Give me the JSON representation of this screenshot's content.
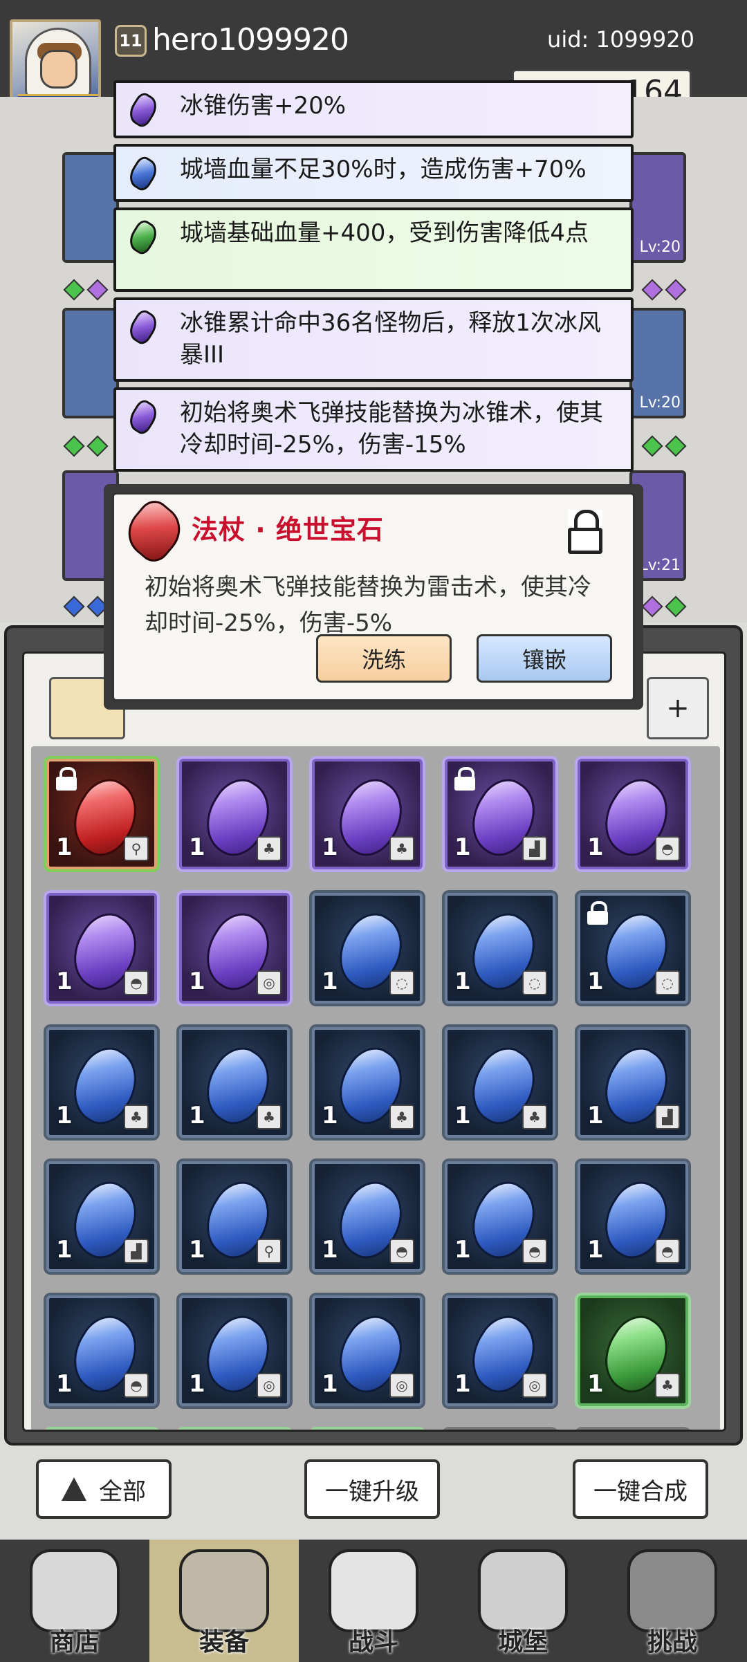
{
  "header": {
    "player_level": "11",
    "player_name": "hero1099920",
    "uid": "uid: 1099920",
    "currency_value": "164"
  },
  "effects": [
    {
      "color": "purple",
      "text": "冰锥伤害+20%"
    },
    {
      "color": "blue",
      "text": "城墙血量不足30%时，造成伤害+70%"
    },
    {
      "color": "green",
      "text": "城墙基础血量+400，受到伤害降低4点"
    },
    {
      "color": "purple",
      "text": "冰锥累计命中36名怪物后，释放1次冰风暴III"
    },
    {
      "color": "purple",
      "text": "初始将奥术飞弹技能替换为冰锥术，使其冷却时间-25%，伤害-15%"
    }
  ],
  "equip_slot_levels": [
    "Lv:20",
    "Lv:20",
    "Lv:21"
  ],
  "gem_popup": {
    "title": "法杖 · 绝世宝石",
    "description": "初始将奥术飞弹技能替换为雷击术，使其冷却时间-25%，伤害-5%",
    "reforge_label": "洗练",
    "inlay_label": "镶嵌",
    "locked": true
  },
  "inventory": {
    "add_button_label": "+",
    "gems": [
      {
        "color": "red",
        "count": "1",
        "slot_icon": "staff-icon",
        "locked": true
      },
      {
        "color": "purple",
        "count": "1",
        "slot_icon": "armor-icon",
        "locked": false
      },
      {
        "color": "purple",
        "count": "1",
        "slot_icon": "armor-icon",
        "locked": false
      },
      {
        "color": "purple",
        "count": "1",
        "slot_icon": "boots-icon",
        "locked": true
      },
      {
        "color": "purple",
        "count": "1",
        "slot_icon": "hat-icon",
        "locked": false
      },
      {
        "color": "purple",
        "count": "1",
        "slot_icon": "hat-icon",
        "locked": false
      },
      {
        "color": "purple",
        "count": "1",
        "slot_icon": "amulet-icon",
        "locked": false
      },
      {
        "color": "blue",
        "count": "1",
        "slot_icon": "ring-icon",
        "locked": false
      },
      {
        "color": "blue",
        "count": "1",
        "slot_icon": "ring-icon",
        "locked": false
      },
      {
        "color": "blue",
        "count": "1",
        "slot_icon": "ring-icon",
        "locked": true
      },
      {
        "color": "blue",
        "count": "1",
        "slot_icon": "armor-icon",
        "locked": false
      },
      {
        "color": "blue",
        "count": "1",
        "slot_icon": "armor-icon",
        "locked": false
      },
      {
        "color": "blue",
        "count": "1",
        "slot_icon": "armor-icon",
        "locked": false
      },
      {
        "color": "blue",
        "count": "1",
        "slot_icon": "armor-icon",
        "locked": false
      },
      {
        "color": "blue",
        "count": "1",
        "slot_icon": "boots-icon",
        "locked": false
      },
      {
        "color": "blue",
        "count": "1",
        "slot_icon": "boots-icon",
        "locked": false
      },
      {
        "color": "blue",
        "count": "1",
        "slot_icon": "staff-icon",
        "locked": false
      },
      {
        "color": "blue",
        "count": "1",
        "slot_icon": "hat-icon",
        "locked": false
      },
      {
        "color": "blue",
        "count": "1",
        "slot_icon": "hat-icon",
        "locked": false
      },
      {
        "color": "blue",
        "count": "1",
        "slot_icon": "hat-icon",
        "locked": false
      },
      {
        "color": "blue",
        "count": "1",
        "slot_icon": "hat-icon",
        "locked": false
      },
      {
        "color": "blue",
        "count": "1",
        "slot_icon": "amulet-icon",
        "locked": false
      },
      {
        "color": "blue",
        "count": "1",
        "slot_icon": "amulet-icon",
        "locked": false
      },
      {
        "color": "blue",
        "count": "1",
        "slot_icon": "amulet-icon",
        "locked": false
      },
      {
        "color": "green",
        "count": "1",
        "slot_icon": "armor-icon",
        "locked": false
      }
    ]
  },
  "actions": {
    "all_label": "全部",
    "upgrade_label": "一键升级",
    "merge_label": "一键合成"
  },
  "nav": [
    {
      "label": "商店",
      "icon": "shop-icon"
    },
    {
      "label": "装备",
      "icon": "backpack-icon"
    },
    {
      "label": "战斗",
      "icon": "swords-icon"
    },
    {
      "label": "城堡",
      "icon": "castle-icon"
    },
    {
      "label": "挑战",
      "icon": "shield-lock-icon"
    }
  ]
}
